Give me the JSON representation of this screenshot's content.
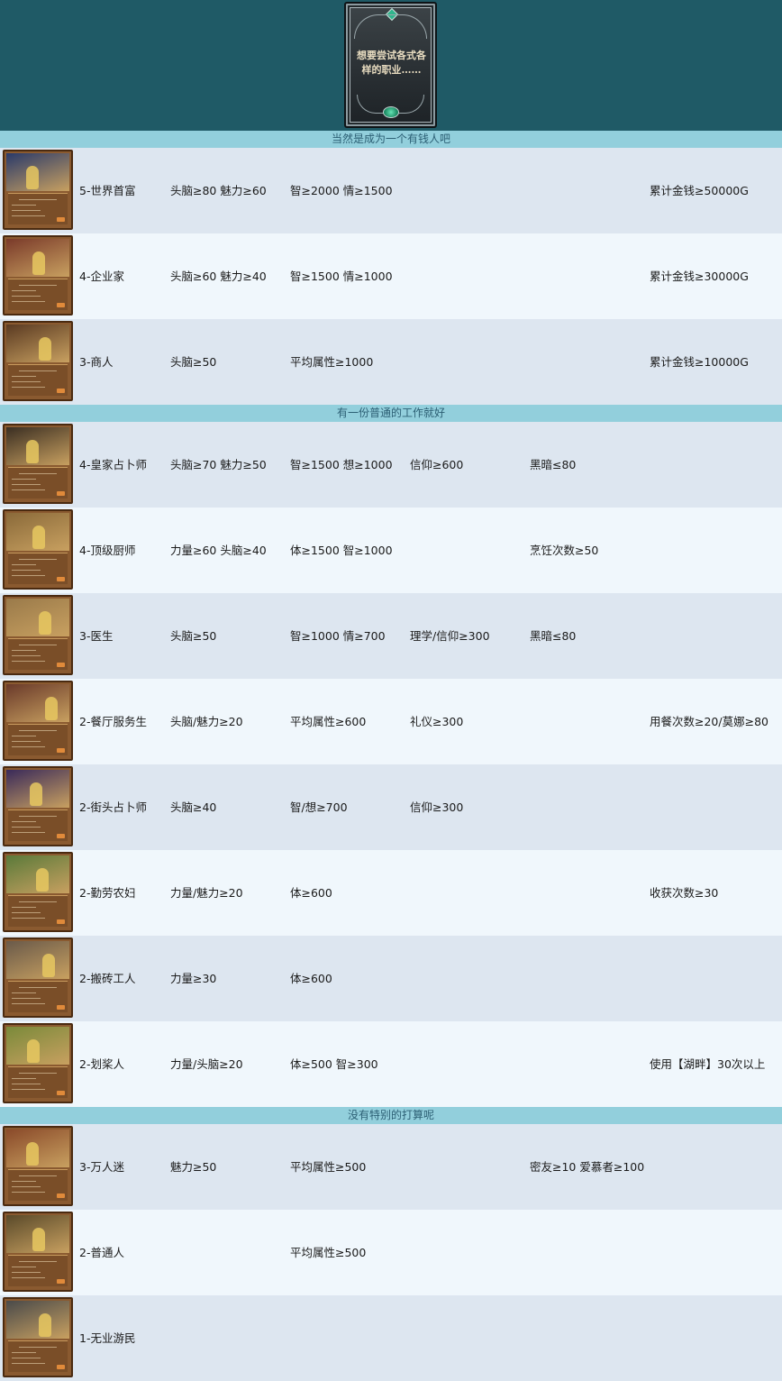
{
  "header": {
    "card_text": "想要尝试各式各样的职业……"
  },
  "sections": [
    {
      "title": "当然是成为一个有钱人吧",
      "rows": [
        {
          "name": "5-世界首富",
          "a": "头脑≥80 魅力≥60",
          "b": "智≥2000 情≥1500",
          "c": "",
          "d": "",
          "e": "累计金钱≥50000G",
          "art": "#2a3a6a"
        },
        {
          "name": "4-企业家",
          "a": "头脑≥60 魅力≥40",
          "b": "智≥1500 情≥1000",
          "c": "",
          "d": "",
          "e": "累计金钱≥30000G",
          "art": "#7a3a2a"
        },
        {
          "name": "3-商人",
          "a": "头脑≥50",
          "b": "平均属性≥1000",
          "c": "",
          "d": "",
          "e": "累计金钱≥10000G",
          "art": "#5a3a22"
        }
      ]
    },
    {
      "title": "有一份普通的工作就好",
      "rows": [
        {
          "name": "4-皇家占卜师",
          "a": "头脑≥70 魅力≥50",
          "b": "智≥1500 想≥1000",
          "c": "信仰≥600",
          "d": "黑暗≤80",
          "e": "",
          "art": "#3a2e22"
        },
        {
          "name": "4-顶级厨师",
          "a": "力量≥60 头脑≥40",
          "b": "体≥1500 智≥1000",
          "c": "",
          "d": "烹饪次数≥50",
          "e": "",
          "art": "#8a6a3a"
        },
        {
          "name": "3-医生",
          "a": "头脑≥50",
          "b": "智≥1000 情≥700",
          "c": "理学/信仰≥300",
          "d": "黑暗≤80",
          "e": "",
          "art": "#9a7a4a"
        },
        {
          "name": "2-餐厅服务生",
          "a": "头脑/魅力≥20",
          "b": "平均属性≥600",
          "c": "礼仪≥300",
          "d": "",
          "e": "用餐次数≥20/莫娜≥80",
          "art": "#6a3a2a"
        },
        {
          "name": "2-街头占卜师",
          "a": "头脑≥40",
          "b": "智/想≥700",
          "c": "信仰≥300",
          "d": "",
          "e": "",
          "art": "#3a2a5a"
        },
        {
          "name": "2-勤劳农妇",
          "a": "力量/魅力≥20",
          "b": "体≥600",
          "c": "",
          "d": "",
          "e": "收获次数≥30",
          "art": "#5a7a3a"
        },
        {
          "name": "2-搬砖工人",
          "a": "力量≥30",
          "b": "体≥600",
          "c": "",
          "d": "",
          "e": "",
          "art": "#6a5a4a"
        },
        {
          "name": "2-划桨人",
          "a": "力量/头脑≥20",
          "b": "体≥500 智≥300",
          "c": "",
          "d": "",
          "e": "使用【湖畔】30次以上",
          "art": "#7a8a3a"
        }
      ]
    },
    {
      "title": "没有特别的打算呢",
      "rows": [
        {
          "name": "3-万人迷",
          "a": "魅力≥50",
          "b": "平均属性≥500",
          "c": "",
          "d": "密友≥10 爱慕者≥100",
          "e": "",
          "art": "#8a4a2a"
        },
        {
          "name": "2-普通人",
          "a": "",
          "b": "平均属性≥500",
          "c": "",
          "d": "",
          "e": "",
          "art": "#5a4a2a"
        },
        {
          "name": "1-无业游民",
          "a": "",
          "b": "",
          "c": "",
          "d": "",
          "e": "",
          "art": "#4a4a4a"
        }
      ]
    }
  ]
}
